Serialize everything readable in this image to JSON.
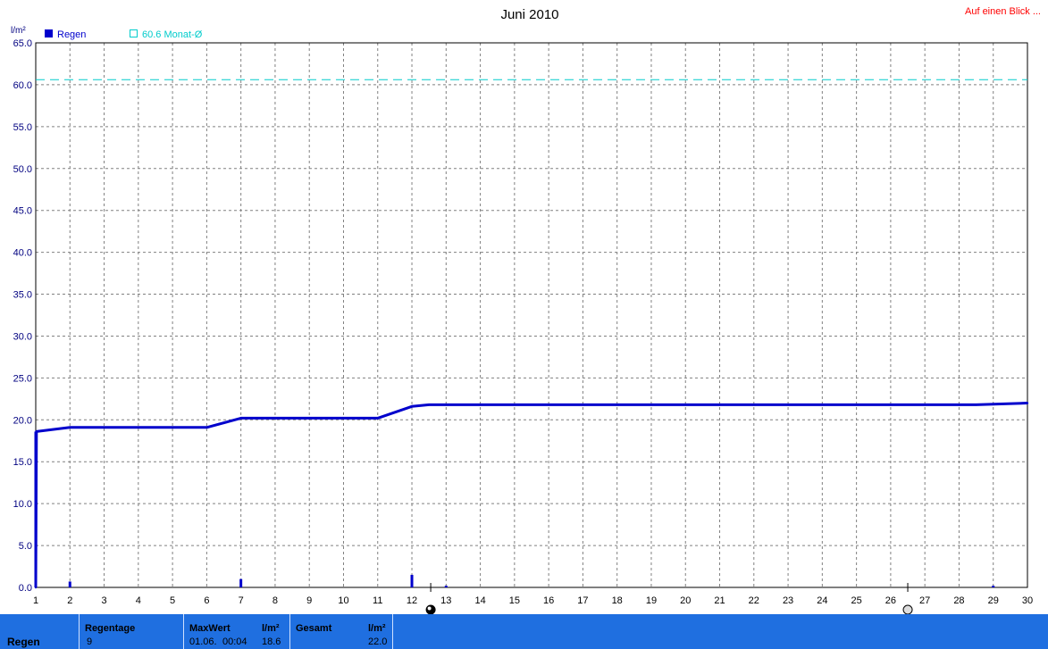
{
  "header": {
    "link": "Auf einen Blick ..."
  },
  "chart_data": {
    "type": "line",
    "title": "Juni 2010",
    "ylabel": "l/m²",
    "ylim": [
      0,
      65
    ],
    "xlim": [
      1,
      30
    ],
    "y_ticks": [
      "0.0",
      "5.0",
      "10.0",
      "15.0",
      "20.0",
      "25.0",
      "30.0",
      "35.0",
      "40.0",
      "45.0",
      "50.0",
      "55.0",
      "60.0",
      "65.0"
    ],
    "x_ticks": [
      "1",
      "2",
      "3",
      "4",
      "5",
      "6",
      "7",
      "8",
      "9",
      "10",
      "11",
      "12",
      "13",
      "14",
      "15",
      "16",
      "17",
      "18",
      "19",
      "20",
      "21",
      "22",
      "23",
      "24",
      "25",
      "26",
      "27",
      "28",
      "29",
      "30"
    ],
    "grid": true,
    "legend": [
      "Regen",
      "60.6 Monat-Ø"
    ],
    "colors": {
      "rain": "#0000cc",
      "average": "#00cccc"
    },
    "series": [
      {
        "name": "Regen",
        "x": [
          1.0,
          1.02,
          2.0,
          6.0,
          7.0,
          11.0,
          12.0,
          12.5,
          28.5,
          30.0
        ],
        "values": [
          0.0,
          18.6,
          19.1,
          19.1,
          20.2,
          20.2,
          21.6,
          21.8,
          21.8,
          22.0
        ]
      }
    ],
    "daily_bars": {
      "x": [
        1.0,
        2.0,
        7.0,
        12.0,
        13.0,
        29.0
      ],
      "values": [
        18.6,
        0.7,
        1.0,
        1.5,
        0.2,
        0.2
      ]
    },
    "average_line": {
      "name": "60.6 Monat-Ø",
      "value": 60.6
    },
    "moon_markers": [
      {
        "x": 12.55,
        "phase": "full-moon"
      },
      {
        "x": 26.5,
        "phase": "new-moon"
      }
    ]
  },
  "footer": {
    "label": "Regen",
    "regentage": {
      "header": "Regentage",
      "value": "9"
    },
    "maxwert": {
      "header": "MaxWert",
      "unit": "l/m²",
      "date": "01.06.",
      "time": "00:04",
      "value": "18.6"
    },
    "gesamt": {
      "header": "Gesamt",
      "unit": "l/m²",
      "value": "22.0"
    }
  }
}
